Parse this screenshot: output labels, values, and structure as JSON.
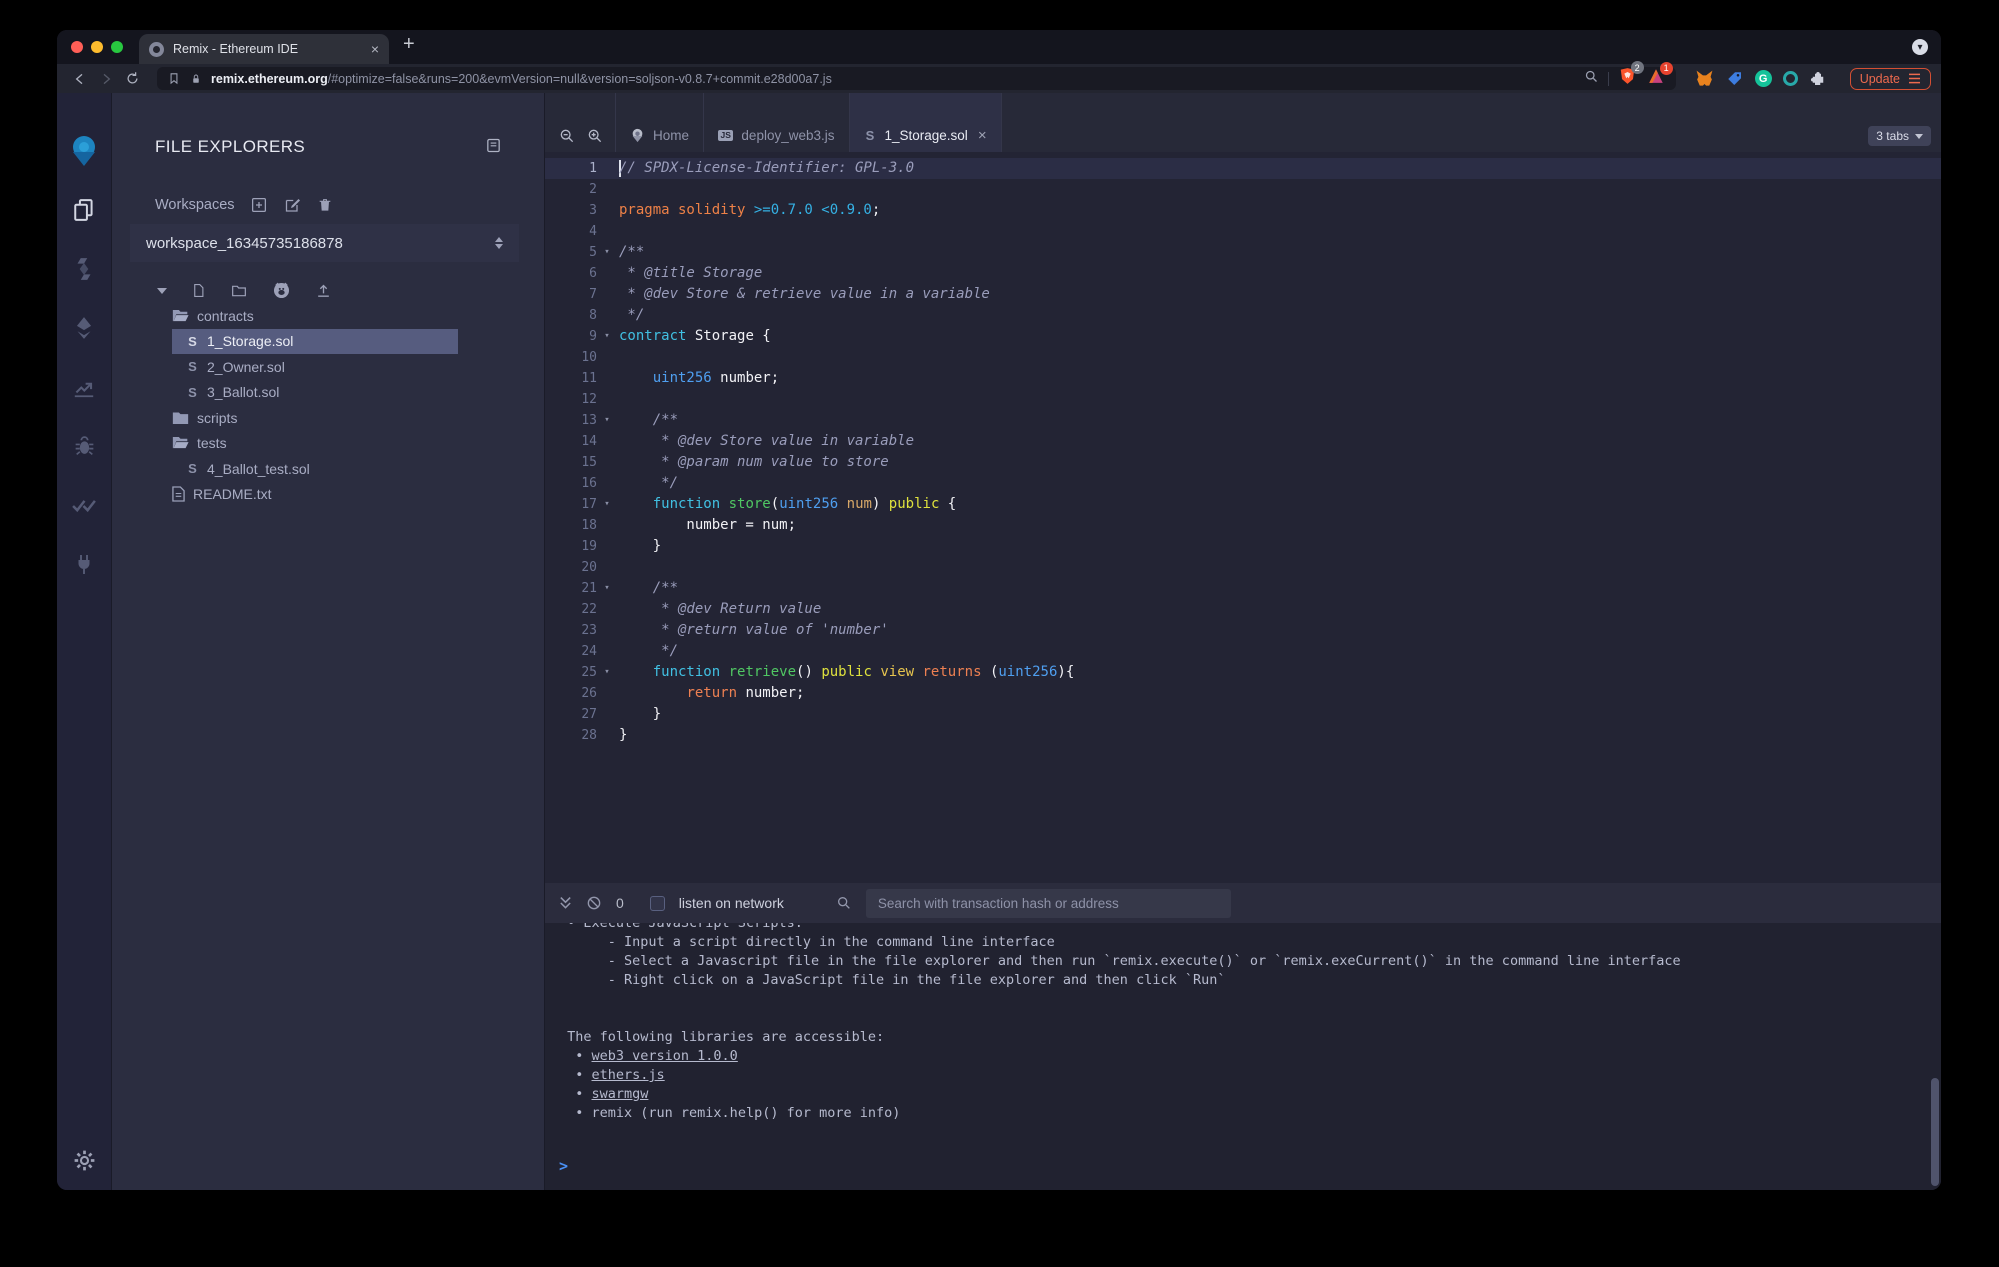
{
  "browser": {
    "tab_title": "Remix - Ethereum IDE",
    "new_tab_glyph": "+",
    "close_glyph": "×",
    "url_host": "remix.ethereum.org",
    "url_path": "/#optimize=false&runs=200&evmVersion=null&version=soljson-v0.8.7+commit.e28d00a7.js",
    "shield_badge": "2",
    "blocker_badge": "1",
    "update_label": "Update"
  },
  "rail": {
    "items": [
      "remix-home",
      "file-explorer",
      "solidity-compiler",
      "deploy-and-run",
      "static-analysis",
      "debugger",
      "solidity-unit-testing",
      "plugin-manager",
      "settings"
    ]
  },
  "explorer": {
    "title": "FILE EXPLORERS",
    "workspaces_label": "Workspaces",
    "workspace_name": "workspace_16345735186878",
    "tree": [
      {
        "type": "folder-open",
        "label": "contracts",
        "indent": 0
      },
      {
        "type": "sol",
        "label": "1_Storage.sol",
        "indent": 1,
        "selected": true
      },
      {
        "type": "sol",
        "label": "2_Owner.sol",
        "indent": 1
      },
      {
        "type": "sol",
        "label": "3_Ballot.sol",
        "indent": 1
      },
      {
        "type": "folder-closed",
        "label": "scripts",
        "indent": 0
      },
      {
        "type": "folder-open",
        "label": "tests",
        "indent": 0
      },
      {
        "type": "sol",
        "label": "4_Ballot_test.sol",
        "indent": 1
      },
      {
        "type": "file",
        "label": "README.txt",
        "indent": 0
      }
    ]
  },
  "editor": {
    "tabs": [
      {
        "label": "Home",
        "icon": "remix",
        "active": false,
        "closable": false
      },
      {
        "label": "deploy_web3.js",
        "icon": "js",
        "active": false,
        "closable": false
      },
      {
        "label": "1_Storage.sol",
        "icon": "sol",
        "active": true,
        "closable": true
      }
    ],
    "tabs_badge": "3 tabs",
    "current_line": 1,
    "fold_lines": [
      5,
      9,
      13,
      17,
      21,
      25
    ],
    "code_lines": [
      [
        [
          "c",
          "// SPDX-License-Identifier: GPL-3.0"
        ]
      ],
      [],
      [
        [
          "o",
          "pragma solidity "
        ],
        [
          "n",
          ">=0.7.0 <0.9.0"
        ],
        [
          "w",
          ";"
        ]
      ],
      [],
      [
        [
          "c",
          "/**"
        ]
      ],
      [
        [
          "c",
          " * @title Storage"
        ]
      ],
      [
        [
          "c",
          " * @dev Store & retrieve value in a variable"
        ]
      ],
      [
        [
          "c",
          " */"
        ]
      ],
      [
        [
          "k",
          "contract"
        ],
        [
          "w",
          " Storage {"
        ]
      ],
      [],
      [
        [
          "w",
          "    "
        ],
        [
          "t",
          "uint256"
        ],
        [
          "w",
          " number;"
        ]
      ],
      [],
      [
        [
          "w",
          "    "
        ],
        [
          "c",
          "/**"
        ]
      ],
      [
        [
          "c",
          "     * @dev Store value in variable"
        ]
      ],
      [
        [
          "c",
          "     * @param num value to store"
        ]
      ],
      [
        [
          "c",
          "     */"
        ]
      ],
      [
        [
          "w",
          "    "
        ],
        [
          "k",
          "function"
        ],
        [
          "w",
          " "
        ],
        [
          "f",
          "store"
        ],
        [
          "w",
          "("
        ],
        [
          "t",
          "uint256"
        ],
        [
          "w",
          " "
        ],
        [
          "p",
          "num"
        ],
        [
          "w",
          ") "
        ],
        [
          "y",
          "public"
        ],
        [
          "w",
          " {"
        ]
      ],
      [
        [
          "w",
          "        number = num;"
        ]
      ],
      [
        [
          "w",
          "    }"
        ]
      ],
      [],
      [
        [
          "w",
          "    "
        ],
        [
          "c",
          "/**"
        ]
      ],
      [
        [
          "c",
          "     * @dev Return value"
        ]
      ],
      [
        [
          "c",
          "     * @return value of 'number'"
        ]
      ],
      [
        [
          "c",
          "     */"
        ]
      ],
      [
        [
          "w",
          "    "
        ],
        [
          "k",
          "function"
        ],
        [
          "w",
          " "
        ],
        [
          "f",
          "retrieve"
        ],
        [
          "w",
          "() "
        ],
        [
          "y",
          "public"
        ],
        [
          "w",
          " "
        ],
        [
          "g",
          "view"
        ],
        [
          "w",
          " "
        ],
        [
          "r",
          "returns"
        ],
        [
          "w",
          " ("
        ],
        [
          "t",
          "uint256"
        ],
        [
          "w",
          "){"
        ]
      ],
      [
        [
          "w",
          "        "
        ],
        [
          "r",
          "return"
        ],
        [
          "w",
          " number;"
        ]
      ],
      [
        [
          "w",
          "    }"
        ]
      ],
      [
        [
          "w",
          "}"
        ]
      ]
    ]
  },
  "terminal": {
    "count": "0",
    "listen_label": "listen on network",
    "search_placeholder": "Search with transaction hash or address",
    "clipped_line": " • Execute JavaScript Scripts:",
    "tips": [
      "      - Input a script directly in the command line interface",
      "      - Select a Javascript file in the file explorer and then run `remix.execute()` or `remix.exeCurrent()` in the command line interface",
      "      - Right click on a JavaScript file in the file explorer and then click `Run`"
    ],
    "libraries_intro": " The following libraries are accessible:",
    "libraries": [
      {
        "bullet": "  • ",
        "label": "web3 version 1.0.0",
        "link": true
      },
      {
        "bullet": "  • ",
        "label": "ethers.js",
        "link": true
      },
      {
        "bullet": "  • ",
        "label": "swarmgw",
        "link": true
      },
      {
        "bullet": "  • ",
        "label": "remix (run remix.help() for more info)",
        "link": false
      }
    ],
    "prompt": ">"
  },
  "colors": {
    "background": "#000000",
    "remix_body": "#222336",
    "panel": "#2b2d40",
    "editor_bg": "#232434",
    "selected_row": "#565c7f",
    "update_button": "#ee6a4e",
    "brave_shield": "#fb542b",
    "syntax_comment": "#9a9dbb",
    "syntax_keyword_orange": "#ee8147",
    "syntax_keyword_cyan": "#41c0e2",
    "syntax_type_blue": "#4f9ff0",
    "syntax_function_green": "#50c763",
    "syntax_public_yellow": "#dfe23d",
    "syntax_returns_orange": "#ed8052",
    "terminal_prompt_blue": "#4a90f4"
  }
}
